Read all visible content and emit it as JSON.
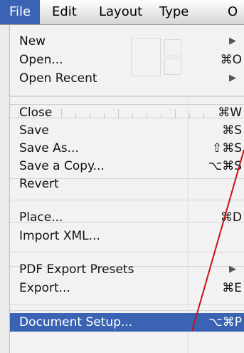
{
  "menubar": {
    "items": [
      "File",
      "Edit",
      "Layout",
      "Type",
      "O"
    ]
  },
  "menu": {
    "items": [
      {
        "label": "New",
        "shortcut": "",
        "submenu": true
      },
      {
        "label": "Open...",
        "shortcut": "⌘O",
        "submenu": false
      },
      {
        "label": "Open Recent",
        "shortcut": "",
        "submenu": true
      },
      {
        "label": "Close",
        "shortcut": "⌘W",
        "submenu": false
      },
      {
        "label": "Save",
        "shortcut": "⌘S",
        "submenu": false
      },
      {
        "label": "Save As...",
        "shortcut": "⇧⌘S",
        "submenu": false
      },
      {
        "label": "Save a Copy...",
        "shortcut": "⌥⌘S",
        "submenu": false
      },
      {
        "label": "Revert",
        "shortcut": "",
        "submenu": false
      },
      {
        "label": "Place...",
        "shortcut": "⌘D",
        "submenu": false
      },
      {
        "label": "Import XML...",
        "shortcut": "",
        "submenu": false
      },
      {
        "label": "PDF Export Presets",
        "shortcut": "",
        "submenu": true
      },
      {
        "label": "Export...",
        "shortcut": "⌘E",
        "submenu": false
      },
      {
        "label": "Document Setup...",
        "shortcut": "⌥⌘P",
        "submenu": false,
        "highlighted": true
      }
    ],
    "submenu_glyph": "▶"
  },
  "colors": {
    "highlight": "#3a63b3",
    "annotation_line": "#cc1111"
  }
}
